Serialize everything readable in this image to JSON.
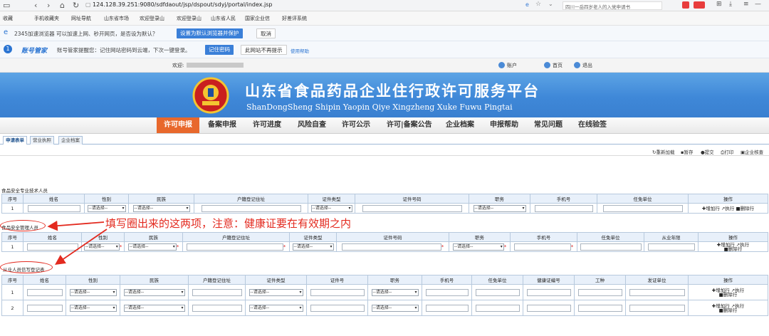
{
  "browser": {
    "url": "124.128.39.251:9080/sdfdaout/jsp/dspout/sdyj/portal/index.jsp",
    "tab_text": "四川一岳四岁老人的入党申请书"
  },
  "bookmarks": [
    "收藏",
    "手机收藏夹",
    "网址导航",
    "山东省市场",
    "欢迎登录山",
    "欢迎登录山",
    "山东省人民",
    "国家企业信",
    "好差评系统"
  ],
  "default_bar": {
    "text": "2345加速浏览器 可以加速上网、秒开网页，是否设为默认？",
    "set_default": "设置为默认浏览器并保护",
    "cancel": "取消"
  },
  "account_bar": {
    "brand": "账号管家",
    "text": "账号管家提醒您：记住网站密码到云端，下次一键登录。",
    "remember": "记住密码",
    "never": "此网站不再提示",
    "help": "使用帮助"
  },
  "welcome": {
    "label": "欢迎:",
    "account": "账户",
    "home": "首页",
    "logout": "退出"
  },
  "banner": {
    "title": "山东省食品药品企业住行政许可服务平台",
    "subtitle": "ShanDongSheng Shipin Yaopin Qiye Xingzheng Xuke Fuwu Pingtai"
  },
  "nav": [
    "许可申报",
    "备案申报",
    "许可进度",
    "风险自查",
    "许可公示",
    "许可|备案公告",
    "企业档案",
    "申报帮助",
    "常见问题",
    "在线验签"
  ],
  "subtabs": [
    "申请表单",
    "营业执照",
    "企业档案"
  ],
  "toolbar": [
    "重新加载",
    "暂存",
    "提交",
    "打印",
    "企业核查"
  ],
  "tech": {
    "title": "食品安全专业技术人员",
    "headers": [
      "序号",
      "姓名",
      "性别",
      "民族",
      "户籍登记住址",
      "证件类型",
      "证件号码",
      "职务",
      "手机号",
      "任免单位",
      "操作"
    ]
  },
  "manager": {
    "title": "食品安全管理人员",
    "headers": [
      "序号",
      "姓名",
      "性别",
      "民族",
      "户籍登记住址",
      "证件类型",
      "证件号码",
      "职务",
      "手机号",
      "任免单位",
      "从业年限",
      "操作"
    ]
  },
  "staff": {
    "title": "从业人员信写登记表",
    "headers": [
      "序号",
      "姓名",
      "性别",
      "民族",
      "户籍登记住址",
      "证件类型",
      "证件号",
      "职务",
      "手机号",
      "任免单位",
      "健康证编号",
      "工种",
      "发证单位",
      "操作"
    ]
  },
  "select_placeholder": "--请选择--",
  "ops": {
    "add": "增加行",
    "edit": "执行",
    "del": "删除行"
  },
  "row_nums": [
    "1",
    "2"
  ],
  "annotation": "填写圈出来的这两项，注意：健康证要在有效期之内",
  "colors": {
    "accent": "#e8682c",
    "annotation": "#e32a1f",
    "banner": "#3f88d8"
  }
}
